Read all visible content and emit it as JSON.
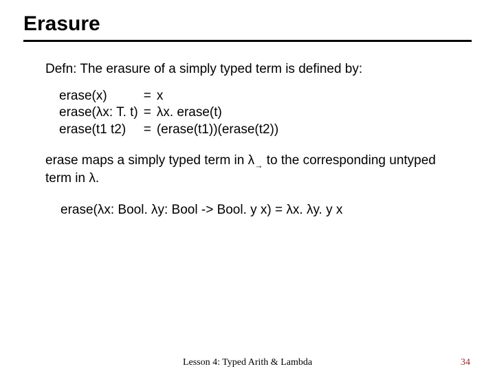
{
  "title": "Erasure",
  "defn": "Defn: The erasure of a simply typed term is defined by:",
  "rules": {
    "r1": {
      "lhs": "erase(x)",
      "eq": "=",
      "rhs": "x"
    },
    "r2": {
      "lhs": "erase(λx: T. t)",
      "eq": "=",
      "rhs": "λx. erase(t)"
    },
    "r3": {
      "lhs": "erase(t1 t2)",
      "eq": "=",
      "rhs": "(erase(t1))(erase(t2))"
    }
  },
  "mapnote": {
    "pre": "erase maps a simply typed term in λ",
    "arrow": "→",
    "post": " to the corresponding untyped term in λ."
  },
  "example": "erase(λx: Bool. λy: Bool -> Bool. y x)  =  λx. λy. y x",
  "footer": {
    "center": "Lesson 4: Typed Arith & Lambda",
    "page": "34"
  }
}
